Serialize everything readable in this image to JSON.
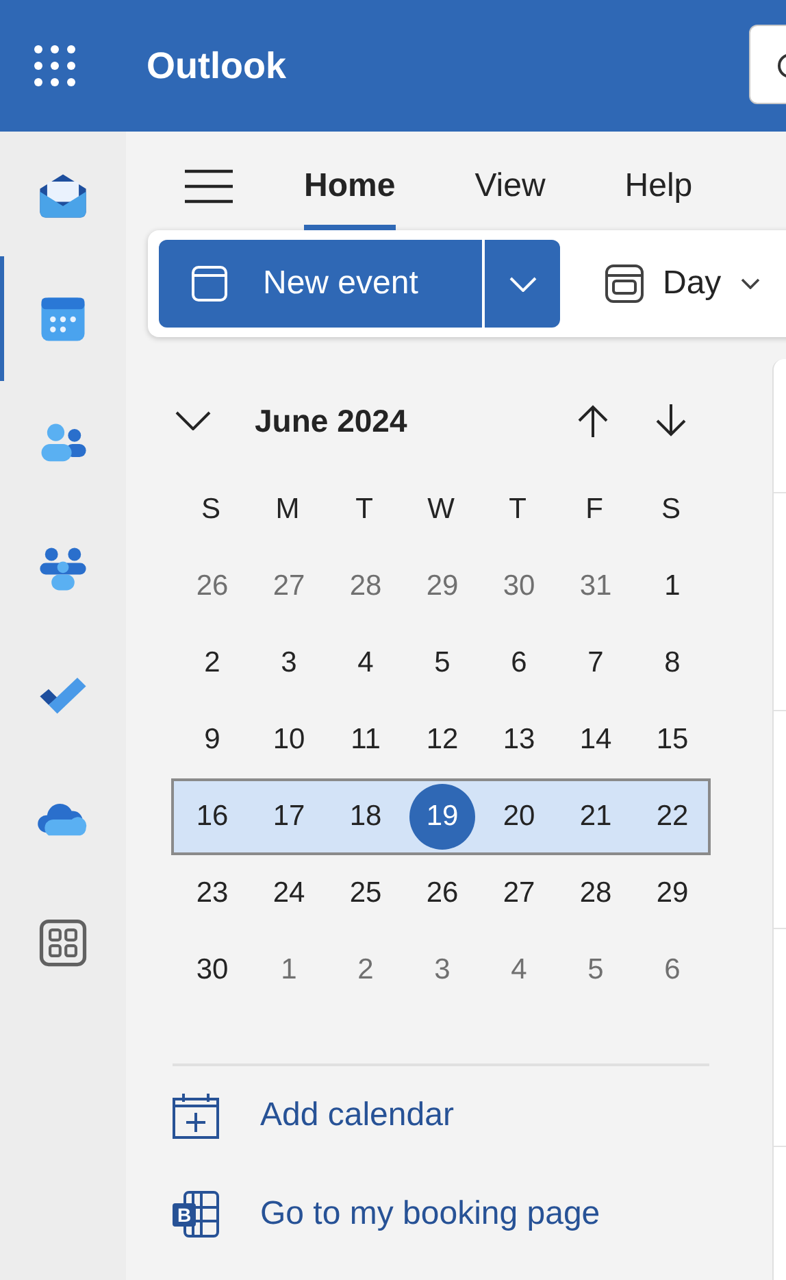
{
  "header": {
    "app_title": "Outlook"
  },
  "rail": {
    "items": [
      {
        "kind": "mail",
        "selected": false
      },
      {
        "kind": "calendar",
        "selected": true
      },
      {
        "kind": "people",
        "selected": false
      },
      {
        "kind": "groups",
        "selected": false
      },
      {
        "kind": "todo",
        "selected": false
      },
      {
        "kind": "cloud",
        "selected": false
      },
      {
        "kind": "apps",
        "selected": false
      }
    ]
  },
  "tabs": [
    {
      "label": "Home",
      "selected": true
    },
    {
      "label": "View",
      "selected": false
    },
    {
      "label": "Help",
      "selected": false
    }
  ],
  "toolbar": {
    "new_event": "New event",
    "view_switch": "Day"
  },
  "mini_calendar": {
    "month_label": "June 2024",
    "weekdays": [
      "S",
      "M",
      "T",
      "W",
      "T",
      "F",
      "S"
    ],
    "weeks": [
      {
        "selected": false,
        "days": [
          {
            "label": "26",
            "outside": true,
            "today": false
          },
          {
            "label": "27",
            "outside": true,
            "today": false
          },
          {
            "label": "28",
            "outside": true,
            "today": false
          },
          {
            "label": "29",
            "outside": true,
            "today": false
          },
          {
            "label": "30",
            "outside": true,
            "today": false
          },
          {
            "label": "31",
            "outside": true,
            "today": false
          },
          {
            "label": "1",
            "outside": false,
            "today": false
          }
        ]
      },
      {
        "selected": false,
        "days": [
          {
            "label": "2",
            "outside": false,
            "today": false
          },
          {
            "label": "3",
            "outside": false,
            "today": false
          },
          {
            "label": "4",
            "outside": false,
            "today": false
          },
          {
            "label": "5",
            "outside": false,
            "today": false
          },
          {
            "label": "6",
            "outside": false,
            "today": false
          },
          {
            "label": "7",
            "outside": false,
            "today": false
          },
          {
            "label": "8",
            "outside": false,
            "today": false
          }
        ]
      },
      {
        "selected": false,
        "days": [
          {
            "label": "9",
            "outside": false,
            "today": false
          },
          {
            "label": "10",
            "outside": false,
            "today": false
          },
          {
            "label": "11",
            "outside": false,
            "today": false
          },
          {
            "label": "12",
            "outside": false,
            "today": false
          },
          {
            "label": "13",
            "outside": false,
            "today": false
          },
          {
            "label": "14",
            "outside": false,
            "today": false
          },
          {
            "label": "15",
            "outside": false,
            "today": false
          }
        ]
      },
      {
        "selected": true,
        "days": [
          {
            "label": "16",
            "outside": false,
            "today": false
          },
          {
            "label": "17",
            "outside": false,
            "today": false
          },
          {
            "label": "18",
            "outside": false,
            "today": false
          },
          {
            "label": "19",
            "outside": false,
            "today": true
          },
          {
            "label": "20",
            "outside": false,
            "today": false
          },
          {
            "label": "21",
            "outside": false,
            "today": false
          },
          {
            "label": "22",
            "outside": false,
            "today": false
          }
        ]
      },
      {
        "selected": false,
        "days": [
          {
            "label": "23",
            "outside": false,
            "today": false
          },
          {
            "label": "24",
            "outside": false,
            "today": false
          },
          {
            "label": "25",
            "outside": false,
            "today": false
          },
          {
            "label": "26",
            "outside": false,
            "today": false
          },
          {
            "label": "27",
            "outside": false,
            "today": false
          },
          {
            "label": "28",
            "outside": false,
            "today": false
          },
          {
            "label": "29",
            "outside": false,
            "today": false
          }
        ]
      },
      {
        "selected": false,
        "days": [
          {
            "label": "30",
            "outside": false,
            "today": false
          },
          {
            "label": "1",
            "outside": true,
            "today": false
          },
          {
            "label": "2",
            "outside": true,
            "today": false
          },
          {
            "label": "3",
            "outside": true,
            "today": false
          },
          {
            "label": "4",
            "outside": true,
            "today": false
          },
          {
            "label": "5",
            "outside": true,
            "today": false
          },
          {
            "label": "6",
            "outside": true,
            "today": false
          }
        ]
      }
    ]
  },
  "links": [
    {
      "kind": "add_calendar",
      "label": "Add calendar"
    },
    {
      "kind": "booking",
      "label": "Go to my booking page",
      "icon_letter": "B"
    }
  ]
}
